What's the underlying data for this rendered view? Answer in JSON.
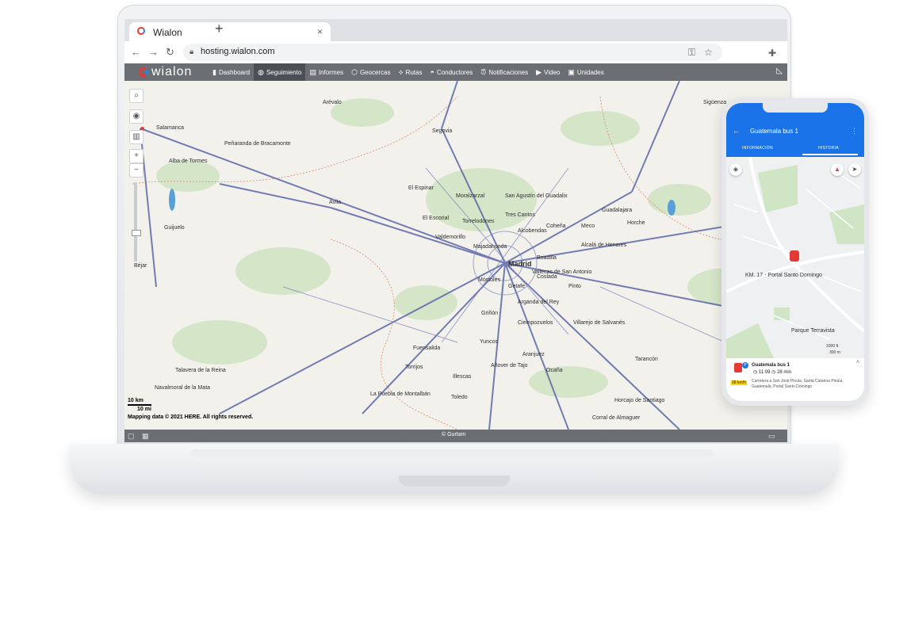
{
  "browser": {
    "tab_title": "Wialon",
    "tab_close": "×",
    "new_tab": "+",
    "url": "hosting.wialon.com"
  },
  "toolbar": {
    "logo": "wialon",
    "items": [
      {
        "icon": "chart-icon",
        "label": "Dashboard"
      },
      {
        "icon": "globe-icon",
        "label": "Seguimiento",
        "active": true
      },
      {
        "icon": "report-icon",
        "label": "Informes"
      },
      {
        "icon": "geofence-icon",
        "label": "Geocercas"
      },
      {
        "icon": "route-icon",
        "label": "Rutas"
      },
      {
        "icon": "driver-icon",
        "label": "Conductores"
      },
      {
        "icon": "alarm-icon",
        "label": "Notificaciones"
      },
      {
        "icon": "video-icon",
        "label": "Video"
      },
      {
        "icon": "bus-icon",
        "label": "Unidades"
      }
    ]
  },
  "map": {
    "labels": [
      "Arévalo",
      "Salamanca",
      "Segovia",
      "Peñaranda de Bracamonte",
      "Alba de Tormes",
      "El Espinar",
      "Moralzarzal",
      "San Agustín del Guadalix",
      "Ávila",
      "El Escorial",
      "Torrelodones",
      "Tres Cantos",
      "Guadalajara",
      "Guijuelo",
      "Valdemorillo",
      "Alcobendas",
      "Coheña",
      "Meco",
      "Horche",
      "Majadahonda",
      "Alcalá de Henares",
      "Béjar",
      "Boadilla",
      "Madrid",
      "Coslada",
      "Móstoles",
      "Vallecas de San Antonio",
      "Getafe",
      "Pinto",
      "Arganda del Rey",
      "Griñón",
      "Ciempozuelos",
      "Villarejo de Salvanés",
      "Yuncos",
      "Fuensalida",
      "Aranjuez",
      "Añover de Tajo",
      "Tarancón",
      "Talavera de la Reina",
      "Torrijos",
      "Illescas",
      "Ocaña",
      "Navalmoral de la Mata",
      "La Puebla de Montalbán",
      "Toledo",
      "Horcajo de Santiago",
      "Corral de Almaguer",
      "Sigüenza"
    ],
    "scale_km": "10 km",
    "scale_mi": "10 mi",
    "attribution": "Mapping data © 2021 HERE. All rights reserved.",
    "status": "© Gurtam"
  },
  "phone": {
    "title": "Guatemala bus 1",
    "tab_info": "INFORMACIÓN",
    "tab_history": "HISTORIA",
    "map_label_1": "KM. 17 - Portal Santo Domingo",
    "map_label_2": "Parque Terravista",
    "scale_ft": "1000 ft",
    "scale_m": "300 m",
    "unit_name": "Guatemala bus 1",
    "time": "11:09",
    "duration": "28 min",
    "speed": "28 km/h",
    "address": "Carretera a San José Pinula, Santa Catarina Pinula, Guatemala, Portal Santo Domingo"
  }
}
